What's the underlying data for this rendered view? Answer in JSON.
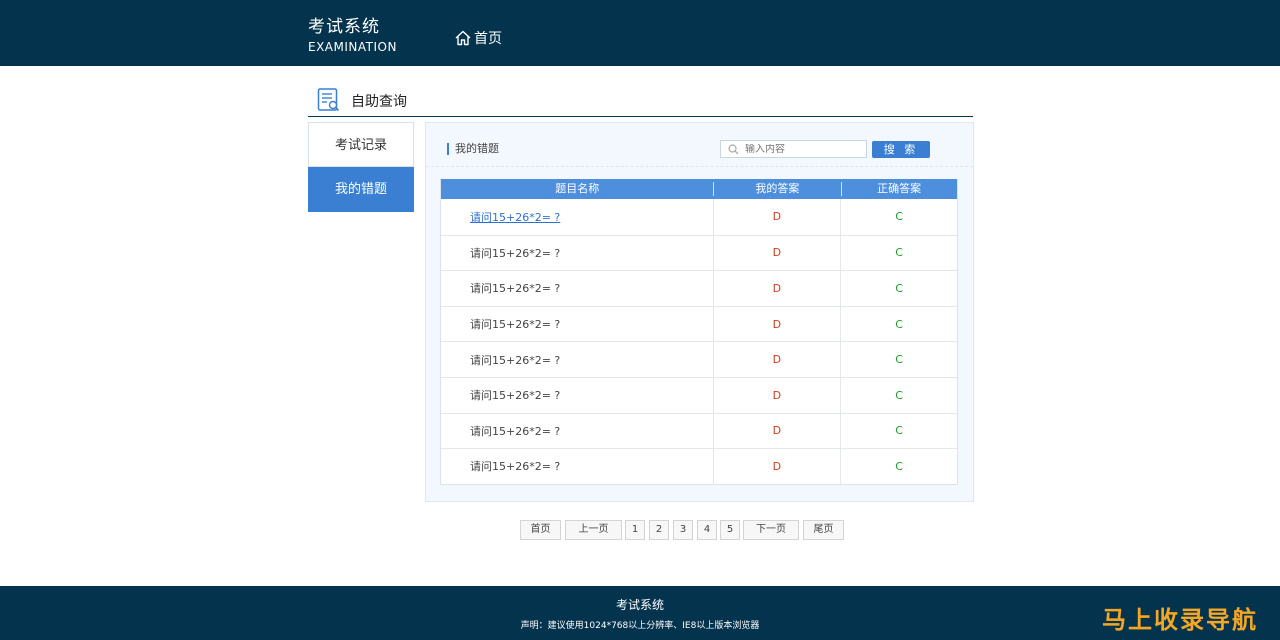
{
  "header": {
    "brand_cn": "考试系统",
    "brand_en": "EXAMINATION",
    "home_label": "首页"
  },
  "section": {
    "title": "自助查询"
  },
  "sidebar": {
    "items": [
      {
        "label": "考试记录",
        "active": false
      },
      {
        "label": "我的错题",
        "active": true
      }
    ]
  },
  "panel": {
    "crumb": "我的错题",
    "search": {
      "placeholder": "输入内容",
      "button": "搜 索"
    },
    "table": {
      "headers": [
        "题目名称",
        "我的答案",
        "正确答案"
      ],
      "rows": [
        {
          "question": "请问15+26*2= ?",
          "mine": "D",
          "correct": "C"
        },
        {
          "question": "请问15+26*2= ?",
          "mine": "D",
          "correct": "C"
        },
        {
          "question": "请问15+26*2= ?",
          "mine": "D",
          "correct": "C"
        },
        {
          "question": "请问15+26*2= ?",
          "mine": "D",
          "correct": "C"
        },
        {
          "question": "请问15+26*2= ?",
          "mine": "D",
          "correct": "C"
        },
        {
          "question": "请问15+26*2= ?",
          "mine": "D",
          "correct": "C"
        },
        {
          "question": "请问15+26*2= ?",
          "mine": "D",
          "correct": "C"
        },
        {
          "question": "请问15+26*2= ?",
          "mine": "D",
          "correct": "C"
        }
      ]
    }
  },
  "pager": {
    "first": "首页",
    "prev": "上一页",
    "pages": [
      "1",
      "2",
      "3",
      "4",
      "5"
    ],
    "next": "下一页",
    "last": "尾页"
  },
  "footer": {
    "title": "考试系统",
    "note": "声明：建议使用1024*768以上分辨率、IE8以上版本浏览器"
  },
  "watermark": "马上收录导航",
  "colors": {
    "header_bg": "#04334e",
    "accent": "#3a7fd1",
    "wrong_answer": "#d23c1e",
    "right_answer": "#1f9a2c"
  }
}
